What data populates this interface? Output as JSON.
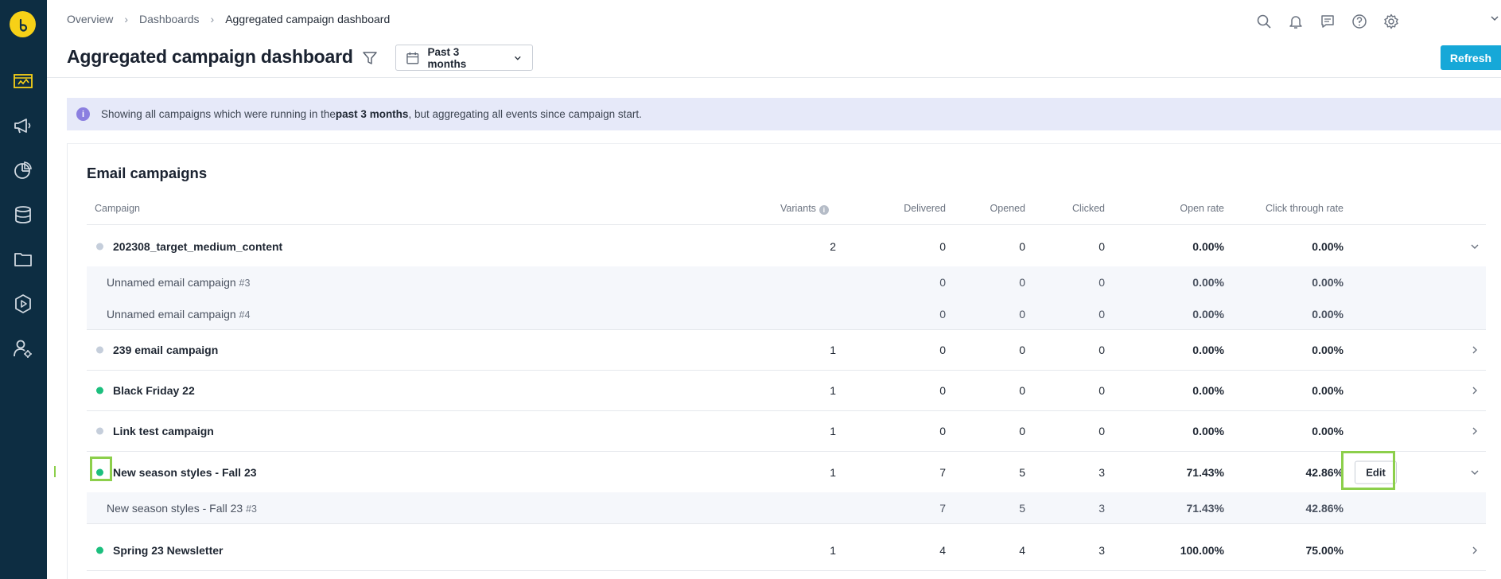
{
  "breadcrumb": {
    "items": [
      "Overview",
      "Dashboards"
    ],
    "current": "Aggregated campaign dashboard"
  },
  "header": {
    "title": "Aggregated campaign dashboard",
    "date_range": "Past 3 months",
    "refresh_label": "Refresh"
  },
  "banner": {
    "text_before": "Showing all campaigns which were running in the ",
    "text_bold": "past 3 months",
    "text_after": ", but aggregating all events since campaign start."
  },
  "section": {
    "title": "Email campaigns"
  },
  "table": {
    "headers": {
      "campaign": "Campaign",
      "variants": "Variants",
      "delivered": "Delivered",
      "opened": "Opened",
      "clicked": "Clicked",
      "open_rate": "Open rate",
      "ctr": "Click through rate"
    },
    "rows": [
      {
        "name": "202308_target_medium_content",
        "status": "inactive",
        "variants": "2",
        "delivered": "0",
        "opened": "0",
        "clicked": "0",
        "open_rate": "0.00%",
        "ctr": "0.00%",
        "expanded": true
      },
      {
        "name": "Unnamed email campaign",
        "index": "#3",
        "delivered": "0",
        "opened": "0",
        "clicked": "0",
        "open_rate": "0.00%",
        "ctr": "0.00%"
      },
      {
        "name": "Unnamed email campaign",
        "index": "#4",
        "delivered": "0",
        "opened": "0",
        "clicked": "0",
        "open_rate": "0.00%",
        "ctr": "0.00%"
      },
      {
        "name": "239 email campaign",
        "status": "inactive",
        "variants": "1",
        "delivered": "0",
        "opened": "0",
        "clicked": "0",
        "open_rate": "0.00%",
        "ctr": "0.00%",
        "expanded": false
      },
      {
        "name": "Black Friday 22",
        "status": "active",
        "variants": "1",
        "delivered": "0",
        "opened": "0",
        "clicked": "0",
        "open_rate": "0.00%",
        "ctr": "0.00%",
        "expanded": false
      },
      {
        "name": "Link test campaign",
        "status": "inactive",
        "variants": "1",
        "delivered": "0",
        "opened": "0",
        "clicked": "0",
        "open_rate": "0.00%",
        "ctr": "0.00%",
        "expanded": false
      },
      {
        "name": "New season styles - Fall 23",
        "status": "active",
        "variants": "1",
        "delivered": "7",
        "opened": "5",
        "clicked": "3",
        "open_rate": "71.43%",
        "ctr": "42.86%",
        "expanded": true,
        "edit_label": "Edit"
      },
      {
        "name": "New season styles - Fall 23",
        "index": "#3",
        "delivered": "7",
        "opened": "5",
        "clicked": "3",
        "open_rate": "71.43%",
        "ctr": "42.86%"
      },
      {
        "name": "Spring 23 Newsletter",
        "status": "active",
        "variants": "1",
        "delivered": "4",
        "opened": "4",
        "clicked": "3",
        "open_rate": "100.00%",
        "ctr": "75.00%",
        "expanded": false
      }
    ]
  },
  "colors": {
    "sidebar": "#0d2d42",
    "logo": "#f7d117",
    "accent": "#16a8d8",
    "active_dot": "#1cbf7e",
    "inactive_dot": "#c5cedb",
    "banner_bg": "#e6e9f9",
    "highlight": "#8ccf4b"
  },
  "icons": {
    "sidebar": [
      "dashboard-icon",
      "megaphone-icon",
      "pie-chart-icon",
      "database-icon",
      "folder-icon",
      "play-icon",
      "user-settings-icon"
    ],
    "topbar": [
      "search-icon",
      "bell-icon",
      "chat-icon",
      "help-icon",
      "gear-icon"
    ]
  }
}
